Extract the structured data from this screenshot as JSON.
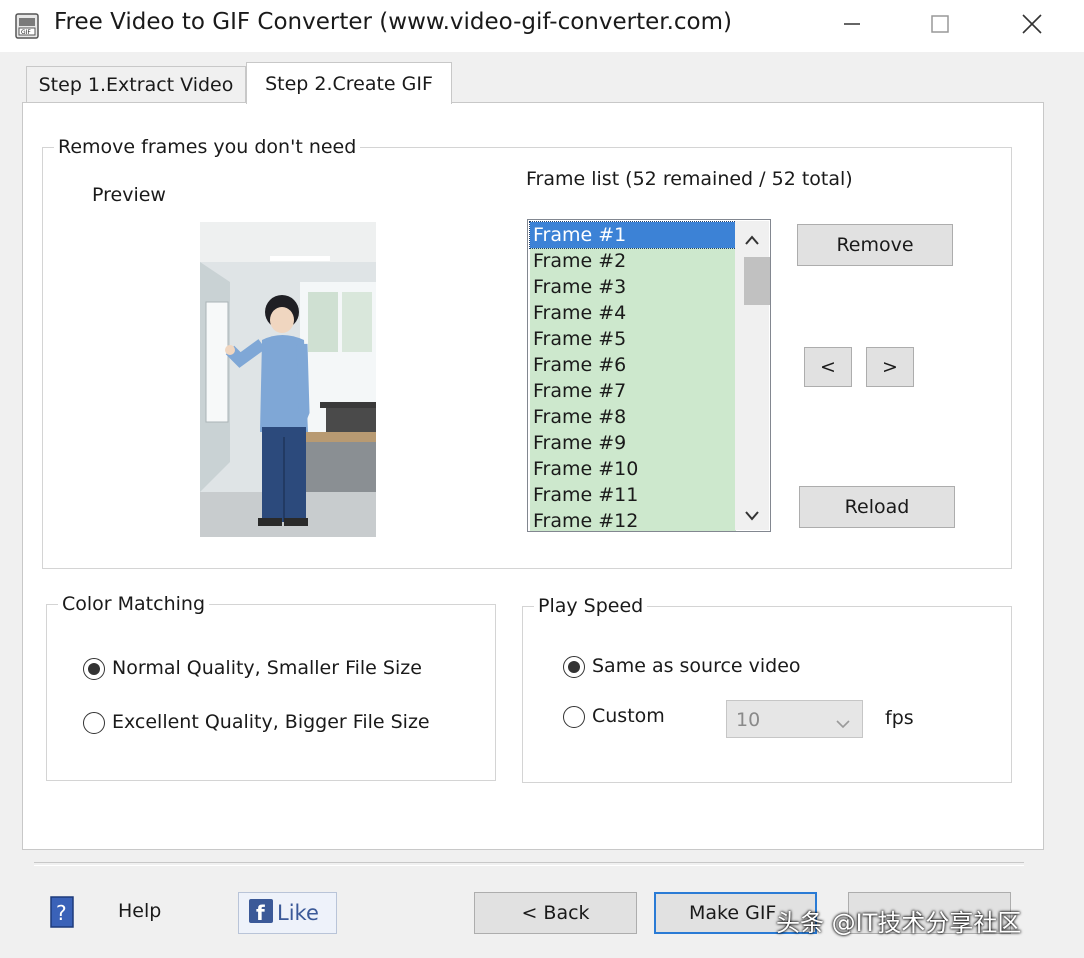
{
  "window": {
    "title": "Free Video to GIF Converter (www.video-gif-converter.com)",
    "app_icon": "gif-app-icon",
    "controls": [
      "minimize-icon",
      "maximize-icon",
      "close-icon"
    ]
  },
  "tabs": [
    {
      "label": "Step 1.Extract Video",
      "active": false
    },
    {
      "label": "Step 2.Create GIF",
      "active": true
    }
  ],
  "frames_group": {
    "legend": "Remove frames you don't need",
    "preview_label": "Preview",
    "frame_list_label": "Frame list (52 remained / 52 total)",
    "frames": [
      "Frame #1",
      "Frame #2",
      "Frame #3",
      "Frame #4",
      "Frame #5",
      "Frame #6",
      "Frame #7",
      "Frame #8",
      "Frame #9",
      "Frame #10",
      "Frame #11",
      "Frame #12"
    ],
    "selected_index": 0,
    "remove_label": "Remove",
    "prev_label": "<",
    "next_label": ">",
    "reload_label": "Reload"
  },
  "color_matching": {
    "legend": "Color Matching",
    "options": [
      {
        "label": "Normal Quality, Smaller File Size",
        "checked": true
      },
      {
        "label": "Excellent Quality, Bigger File Size",
        "checked": false
      }
    ]
  },
  "play_speed": {
    "legend": "Play Speed",
    "options": [
      {
        "label": "Same as source video",
        "checked": true
      },
      {
        "label": "Custom",
        "checked": false
      }
    ],
    "fps_value": "10",
    "fps_unit": "fps"
  },
  "footer": {
    "help_label": "Help",
    "like_label": "Like",
    "back_label": "< Back",
    "make_gif_label": "Make GIF",
    "watermark": "头条 @IT技术分享社区"
  },
  "colors": {
    "list_bg": "#cde8cd",
    "list_selected": "#3c82d6",
    "focus_border": "#2a7bd5"
  }
}
